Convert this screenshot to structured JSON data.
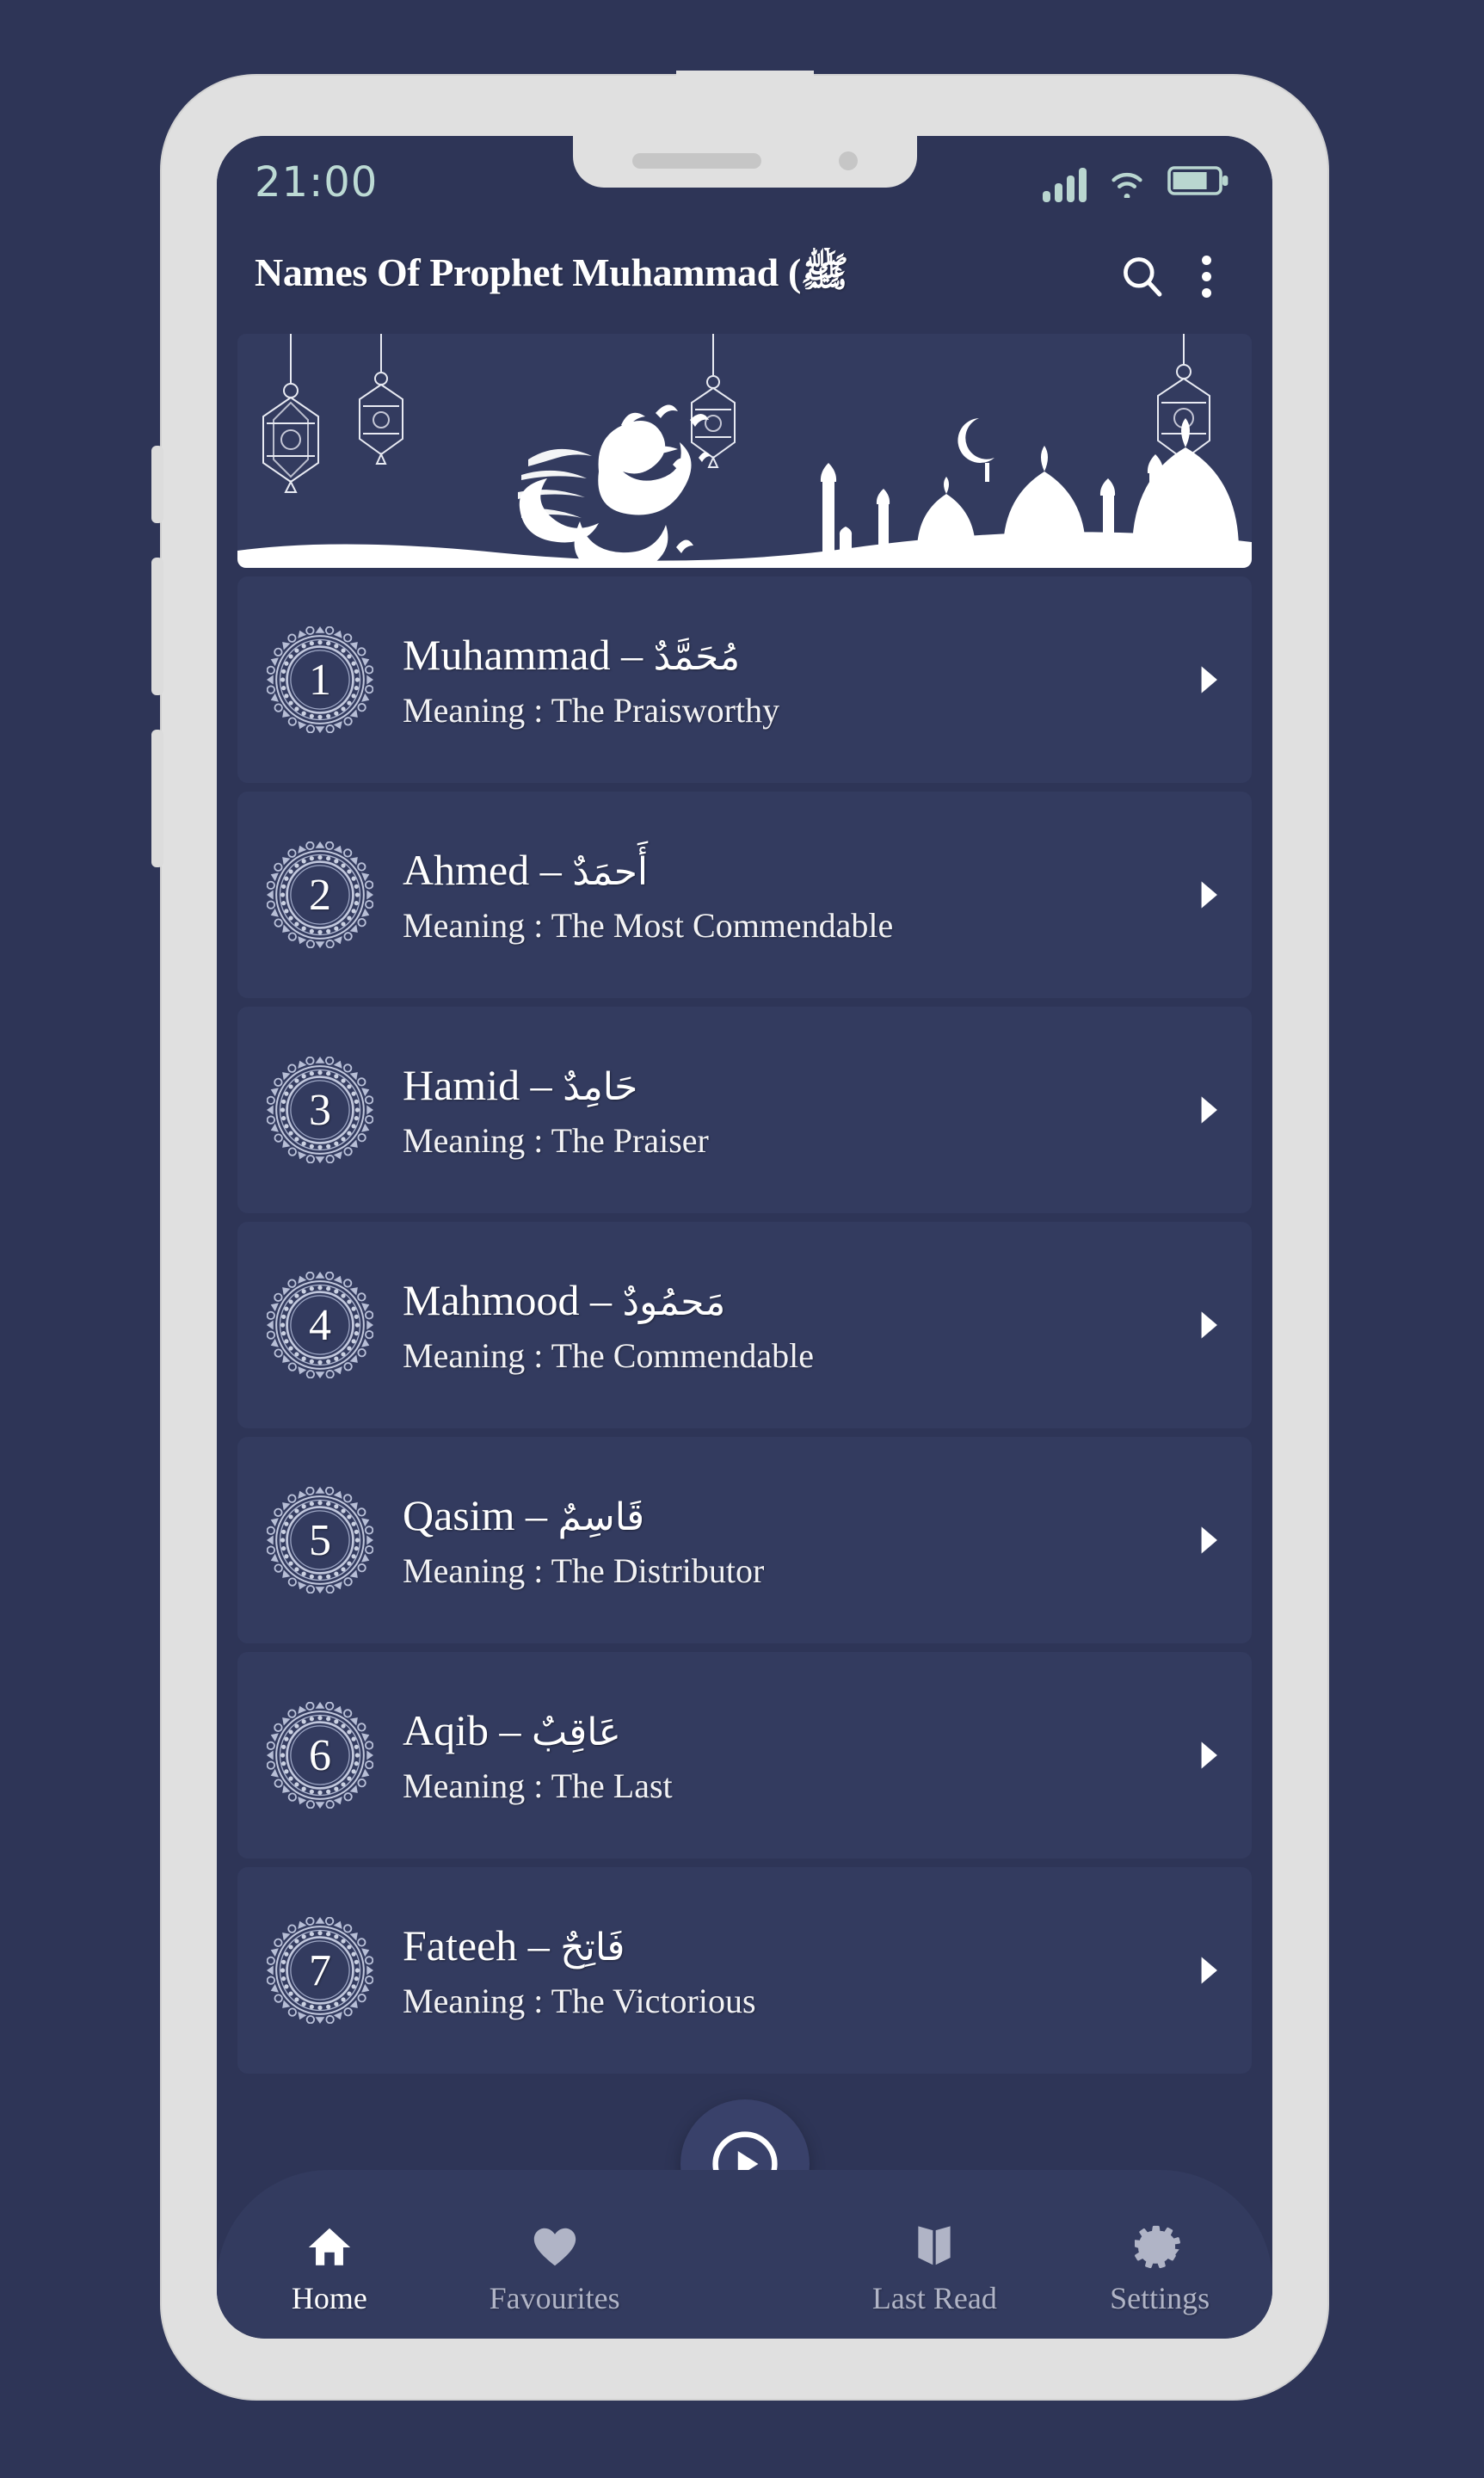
{
  "status_bar": {
    "time": "21:00",
    "signal_icon": "signal-bars-icon",
    "wifi_icon": "wifi-icon",
    "battery_icon": "battery-icon",
    "battery_level_percent": 72
  },
  "app_bar": {
    "title": "Names Of Prophet Muhammad (ﷺ",
    "search_icon": "search-icon",
    "overflow_icon": "more-vert-icon"
  },
  "banner": {
    "calligraphy_alt": "Muhammad calligraphy",
    "lantern_icon": "lantern-icon",
    "mosque_icon": "mosque-silhouette-icon",
    "crescent_icon": "crescent-moon-icon"
  },
  "list": {
    "meaning_prefix": "Meaning : ",
    "separator": "–",
    "chevron_icon": "chevron-right-icon",
    "items": [
      {
        "number": "1",
        "name": "Muhammad",
        "arabic": "مُحَمَّدٌ",
        "meaning": "The Praisworthy"
      },
      {
        "number": "2",
        "name": "Ahmed",
        "arabic": "أَحمَدٌ",
        "meaning": "The Most Commendable"
      },
      {
        "number": "3",
        "name": "Hamid",
        "arabic": "حَامِدٌ",
        "meaning": "The Praiser"
      },
      {
        "number": "4",
        "name": "Mahmood",
        "arabic": "مَحمُودٌ",
        "meaning": "The Commendable"
      },
      {
        "number": "5",
        "name": "Qasim",
        "arabic": "قَاسِمٌ",
        "meaning": "The Distributor"
      },
      {
        "number": "6",
        "name": "Aqib",
        "arabic": "عَاقِبٌ",
        "meaning": "The Last"
      },
      {
        "number": "7",
        "name": "Fateeh",
        "arabic": "فَاتِحٌ",
        "meaning": "The Victorious"
      }
    ]
  },
  "fab": {
    "icon": "play-circle-icon"
  },
  "bottom_nav": {
    "items": [
      {
        "label": "Home",
        "icon": "home-icon",
        "active": true
      },
      {
        "label": "Favourites",
        "icon": "heart-icon",
        "active": false
      },
      {
        "label": "Last Read",
        "icon": "book-icon",
        "active": false
      },
      {
        "label": "Settings",
        "icon": "gear-icon",
        "active": false
      }
    ]
  },
  "colors": {
    "background": "#2e3557",
    "card": "#333b5f",
    "accent_text": "#bcdad4",
    "white": "#ffffff",
    "muted": "#b0b4c6"
  }
}
